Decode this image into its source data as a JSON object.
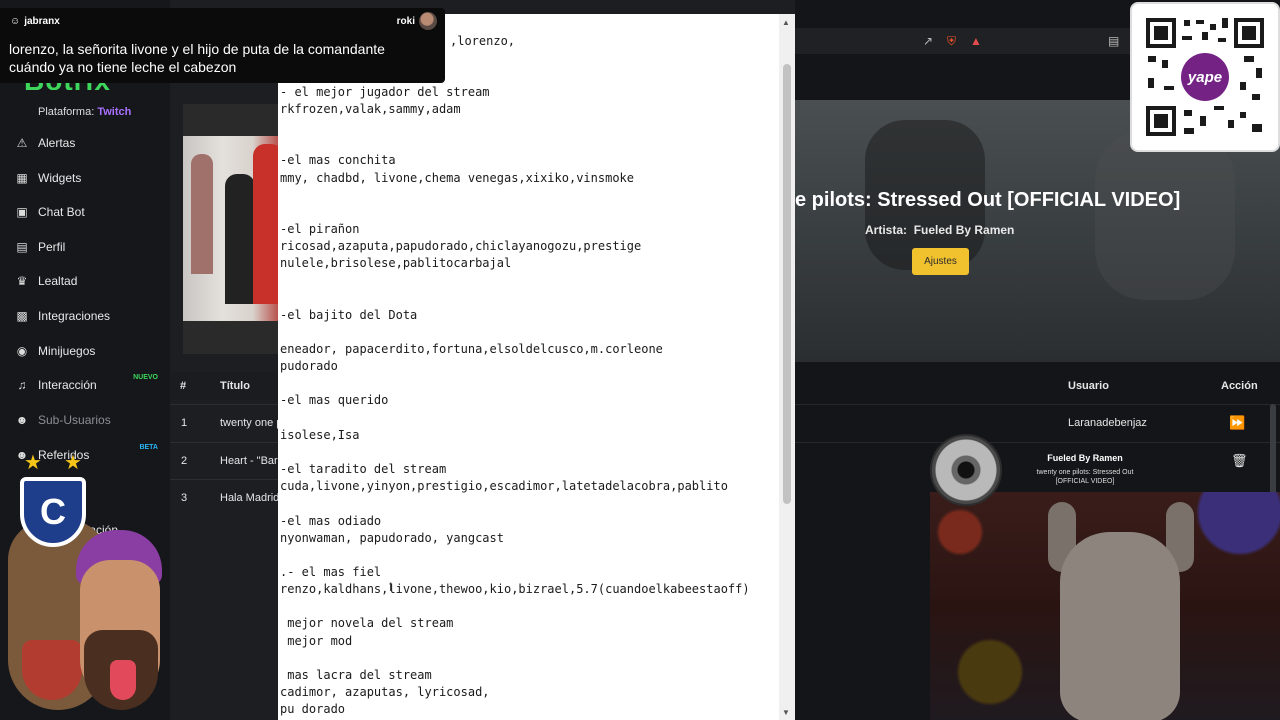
{
  "chat": {
    "viewer": "jabranx",
    "sender": "roki",
    "message": "lorenzo, la señorita livone y el hijo de puta de la comandante cuándo ya no tiene leche el cabezon"
  },
  "sidebar": {
    "logo": "Botrix",
    "platform_label": "Plataforma:",
    "platform_value": "Twitch",
    "items": [
      {
        "label": "Alertas",
        "icon": "warning-icon"
      },
      {
        "label": "Widgets",
        "icon": "grid-icon"
      },
      {
        "label": "Chat Bot",
        "icon": "robot-icon"
      },
      {
        "label": "Perfil",
        "icon": "id-card-icon"
      },
      {
        "label": "Lealtad",
        "icon": "trophy-icon"
      },
      {
        "label": "Integraciones",
        "icon": "puzzle-icon"
      },
      {
        "label": "Minijuegos",
        "icon": "gamepad-icon"
      },
      {
        "label": "Interacción",
        "icon": "music-icon",
        "badge": "NUEVO"
      },
      {
        "label": "Sub-Usuarios",
        "icon": "users-icon"
      },
      {
        "label": "Referidos",
        "icon": "users-icon",
        "badge": "BETA"
      }
    ],
    "partial_item": "tación"
  },
  "queue": {
    "headers": {
      "num": "#",
      "title": "Título",
      "user": "Usuario",
      "action": "Acción"
    },
    "rows": [
      {
        "num": "1",
        "title": "twenty one pi",
        "user": "Laranadebenjaz",
        "action_icon": "skip-forward-icon"
      },
      {
        "num": "2",
        "title": "Heart - \"Barr",
        "user": "",
        "action_icon": "trash-icon"
      },
      {
        "num": "3",
        "title": "Hala Madrid",
        "user": "",
        "action_icon": ""
      }
    ]
  },
  "player": {
    "song_title": "e pilots: Stressed Out [OFFICIAL VIDEO]",
    "artist_label": "Artista:",
    "artist": "Fueled By Ramen",
    "settings_label": "Ajustes"
  },
  "now_playing": {
    "artist": "Fueled By Ramen",
    "song": "twenty one pilots: Stressed Out [OFFICIAL VIDEO]"
  },
  "qr": {
    "label": "yape",
    "accent": "#742284"
  },
  "notepad": {
    "lines": [
      {
        "text": ",lorenzo,",
        "indent": 170
      },
      {
        "text": "- el mejor jugador del stream",
        "indent": 0
      },
      {
        "text": "rkfrozen,valak,sammy,adam",
        "indent": 0
      },
      {
        "text": "-el mas conchita",
        "indent": 0
      },
      {
        "text": "mmy, chadbd, livone,chema venegas,xixiko,vinsmoke",
        "indent": 0
      },
      {
        "text": "-el pirañon",
        "indent": 0
      },
      {
        "text": "ricosad,azaputa,papudorado,chiclayanogozu,prestige",
        "indent": 0
      },
      {
        "text": "nulele,brisolese,pablitocarbajal",
        "indent": 0
      },
      {
        "text": "-el bajito del Dota",
        "indent": 0
      },
      {
        "text": "eneador, papacerdito,fortuna,elsoldelcusco,m.corleone",
        "indent": 0
      },
      {
        "text": "pudorado",
        "indent": 0
      },
      {
        "text": "-el mas querido",
        "indent": 0
      },
      {
        "text": "isolese,Isa",
        "indent": 0
      },
      {
        "text": "-el taradito del stream",
        "indent": 0
      },
      {
        "text": "cuda,livone,yinyon,prestigio,escadimor,latetadelacobra,pablito",
        "indent": 0
      },
      {
        "text": "-el mas odiado",
        "indent": 0
      },
      {
        "text": "nyonwaman, papudorado, yangcast",
        "indent": 0
      },
      {
        "text": ".- el mas fiel",
        "indent": 0
      },
      {
        "text": "renzo,kaldhans,livone,thewoo,kio,bizrael,5.7(cuandoelkabeestaoff)",
        "indent": 0
      },
      {
        "text": " mejor novela del stream",
        "indent": 0
      },
      {
        "text": " mejor mod",
        "indent": 0
      },
      {
        "text": " mas lacra del stream",
        "indent": 0
      },
      {
        "text": "cadimor, azaputas, lyricosad,",
        "indent": 0
      },
      {
        "text": "pu dorado",
        "indent": 0
      }
    ]
  },
  "colors": {
    "brand_green": "#3ed65b",
    "twitch_purple": "#a970ff",
    "settings_yellow": "#f2c12e"
  }
}
